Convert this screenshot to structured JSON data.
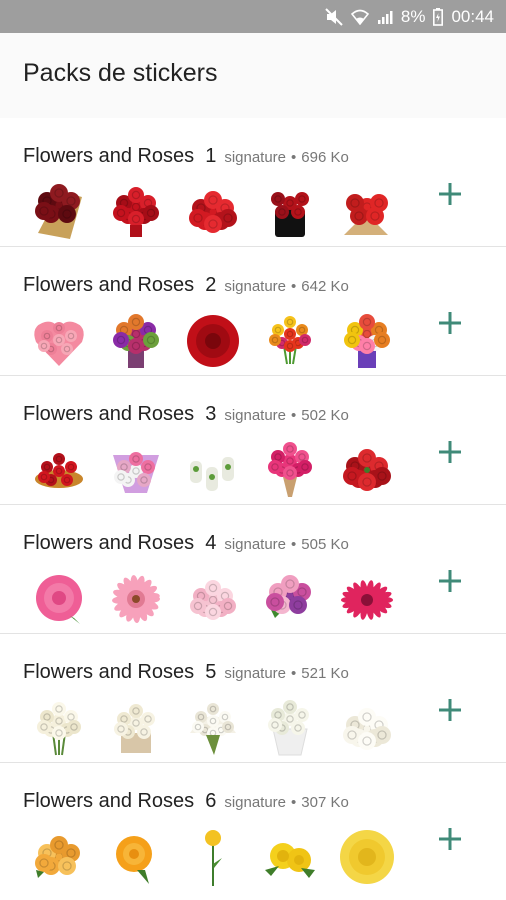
{
  "status_bar": {
    "battery_percent": "8%",
    "time": "00:44",
    "icons": [
      "mute-icon",
      "wifi-icon",
      "signal-icon",
      "battery-charging-icon"
    ]
  },
  "app_bar": {
    "title": "Packs de stickers"
  },
  "packs": [
    {
      "name": "Flowers and Roses",
      "number": "1",
      "publisher": "signature",
      "size": "696 Ko",
      "stickers": [
        "red-rose-bouquet-wrapped",
        "red-rose-bouquet-ribbon",
        "red-rose-bunch",
        "red-roses-black-box",
        "red-roses-in-wrap"
      ]
    },
    {
      "name": "Flowers and Roses",
      "number": "2",
      "publisher": "signature",
      "size": "642 Ko",
      "stickers": [
        "pink-rose-heart",
        "mixed-flower-vase",
        "single-red-rose",
        "tulip-bouquet",
        "mixed-bouquet-purple-vase"
      ]
    },
    {
      "name": "Flowers and Roses",
      "number": "3",
      "publisher": "signature",
      "size": "502 Ko",
      "stickers": [
        "red-rose-basket",
        "pink-wrapped-bouquet",
        "white-vases",
        "pink-rose-bouquet",
        "red-rose-arrangement"
      ]
    },
    {
      "name": "Flowers and Roses",
      "number": "4",
      "publisher": "signature",
      "size": "505 Ko",
      "stickers": [
        "pink-peony",
        "pink-gerbera",
        "pink-carnations",
        "peony-mix",
        "magenta-gerbera"
      ]
    },
    {
      "name": "Flowers and Roses",
      "number": "5",
      "publisher": "signature",
      "size": "521 Ko",
      "stickers": [
        "white-rose-bouquet",
        "white-roses-box",
        "white-rose-dome",
        "white-rose-wrapped",
        "white-roses-cluster"
      ]
    },
    {
      "name": "Flowers and Roses",
      "number": "6",
      "publisher": "signature",
      "size": "307 Ko",
      "stickers": [
        "yellow-roses-peach",
        "yellow-rose-orange",
        "single-yellow-rose",
        "yellow-roses-pair",
        "large-yellow-rose"
      ]
    }
  ],
  "colors": {
    "status_bar": "#9e9e9e",
    "accent_add": "#3f8a78",
    "divider": "#e3e3e3"
  },
  "add_icon": "plus-icon"
}
